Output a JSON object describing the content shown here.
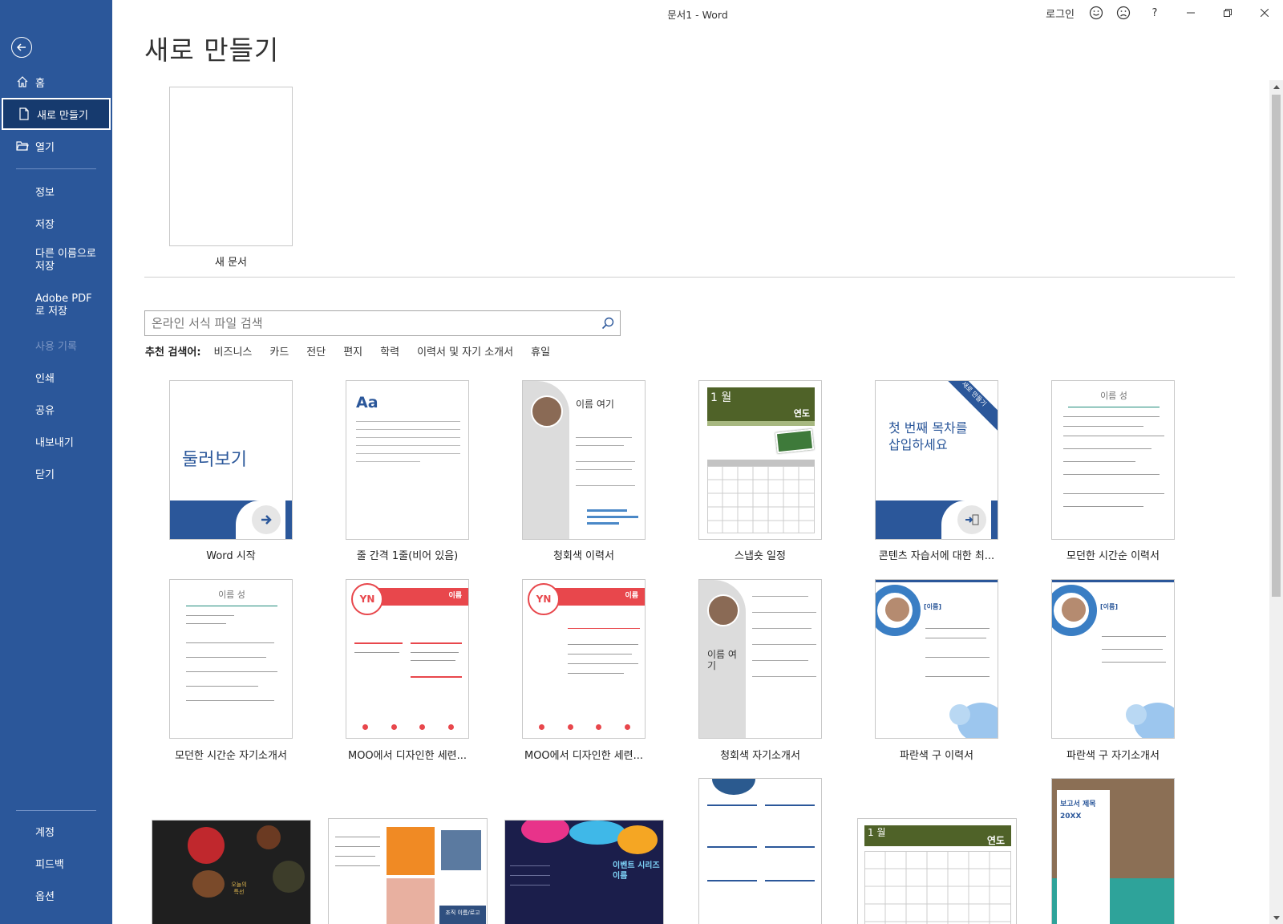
{
  "window": {
    "title": "문서1  -  Word",
    "signin": "로그인",
    "help": "?"
  },
  "sidebar": {
    "items": [
      {
        "label": "홈"
      },
      {
        "label": "새로 만들기"
      },
      {
        "label": "열기"
      },
      {
        "label": "정보"
      },
      {
        "label": "저장"
      },
      {
        "label": "다른 이름으로 저장"
      },
      {
        "label": "Adobe PDF로 저장"
      },
      {
        "label": "사용 기록"
      },
      {
        "label": "인쇄"
      },
      {
        "label": "공유"
      },
      {
        "label": "내보내기"
      },
      {
        "label": "닫기"
      },
      {
        "label": "계정"
      },
      {
        "label": "피드백"
      },
      {
        "label": "옵션"
      }
    ]
  },
  "main": {
    "title": "새로 만들기",
    "blank_doc": "새 문서",
    "search_placeholder": "온라인 서식 파일 검색",
    "suggest_label": "추천 검색어:",
    "suggest_links": [
      "비즈니스",
      "카드",
      "전단",
      "편지",
      "학력",
      "이력서 및 자기 소개서",
      "휴일"
    ],
    "templates": [
      {
        "caption": "Word 시작",
        "text": "둘러보기"
      },
      {
        "caption": "줄 간격 1줄(비어 있음)",
        "text": "Aa"
      },
      {
        "caption": "청회색 이력서",
        "text": "이름 여기"
      },
      {
        "caption": "스냅숏 일정",
        "text": "1 월",
        "text2": "연도"
      },
      {
        "caption": "콘텐츠 자습서에 대한 최...",
        "text": "첫 번째 목차를 삽입하세요",
        "badge": "새로 만들기"
      },
      {
        "caption": "모던한 시간순 이력서",
        "text": "이름 성"
      },
      {
        "caption": "모던한 시간순 자기소개서",
        "text": "이름 성"
      },
      {
        "caption": "MOO에서 디자인한 세련...",
        "text": "YN",
        "text2": "이름"
      },
      {
        "caption": "MOO에서 디자인한 세련...",
        "text": "YN",
        "text2": "이름"
      },
      {
        "caption": "청회색 자기소개서",
        "text": "이름 여기"
      },
      {
        "caption": "파란색 구 이력서",
        "text": "[이름]"
      },
      {
        "caption": "파란색 구 자기소개서",
        "text": "[이름]"
      },
      {
        "caption": "",
        "text": "오늘의 특선"
      },
      {
        "caption": "",
        "text": "조직 이름/로고"
      },
      {
        "caption": "",
        "text": "이벤트 시리즈 이름"
      },
      {
        "caption": "",
        "text": ""
      },
      {
        "caption": "",
        "text": "1 월",
        "text2": "연도"
      },
      {
        "caption": "",
        "text": "보고서 제목",
        "text2": "20XX"
      }
    ]
  },
  "colors": {
    "sidebar": "#2b579a",
    "accent_blue": "#2b579a",
    "olive": "#4f6228",
    "moo_red": "#e8474c"
  }
}
